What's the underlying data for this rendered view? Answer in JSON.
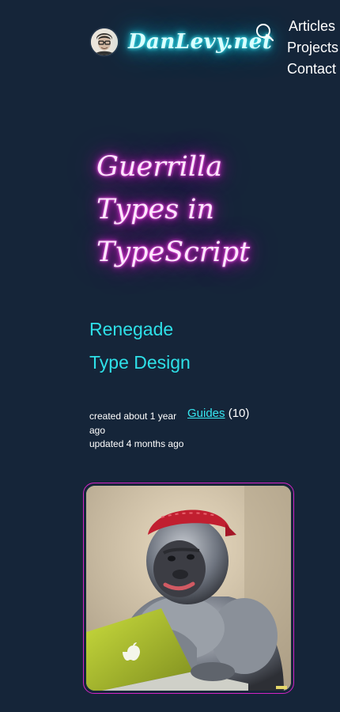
{
  "header": {
    "site_name": "DanLevy.net",
    "avatar": "author-avatar",
    "search_icon": "search-icon",
    "nav": [
      "Articles",
      "Projects",
      "Contact"
    ]
  },
  "article": {
    "title_lines": [
      "Guerrilla",
      "Types in",
      "TypeScript"
    ],
    "subtitle_lines": [
      "Renegade",
      "Type Design"
    ],
    "created": "created about 1 year ago",
    "updated": "updated 4 months ago",
    "category": {
      "label": "Guides",
      "count": "(10)"
    },
    "image": "gorilla-with-laptop-illustration"
  },
  "colors": {
    "background": "#152539",
    "neon_cyan": "#2ee0e8",
    "neon_magenta": "#f21ee3",
    "card_border": "#d324c6"
  }
}
